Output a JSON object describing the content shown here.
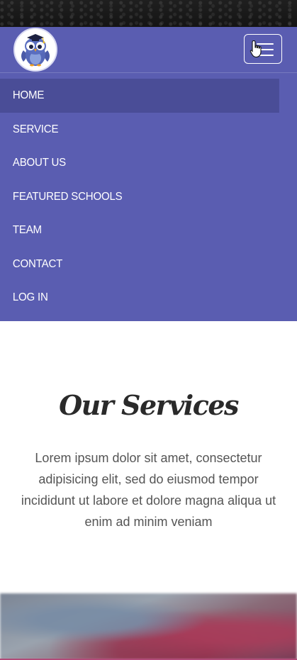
{
  "navbar": {
    "logo_icon": "owl-graduation-cap-icon",
    "toggle_icon": "hamburger-menu-icon",
    "cursor_icon": "hand-pointer-cursor-icon",
    "items": [
      {
        "label": "HOME",
        "active": true
      },
      {
        "label": "SERVICE",
        "active": false
      },
      {
        "label": "ABOUT US",
        "active": false
      },
      {
        "label": "FEATURED SCHOOLS",
        "active": false
      },
      {
        "label": "TEAM",
        "active": false
      },
      {
        "label": "CONTACT",
        "active": false
      },
      {
        "label": "LOG IN",
        "active": false
      }
    ]
  },
  "services": {
    "title": "Our Services",
    "text": "Lorem ipsum dolor sit amet, consectetur adipisicing elit, sed do eiusmod tempor incididunt ut labore et dolore magna aliqua ut enim ad minim veniam"
  },
  "colors": {
    "nav_background": "#5a5db1",
    "nav_active": "#4a4d97",
    "title_text": "#2a2a2a",
    "body_text": "#555555"
  }
}
